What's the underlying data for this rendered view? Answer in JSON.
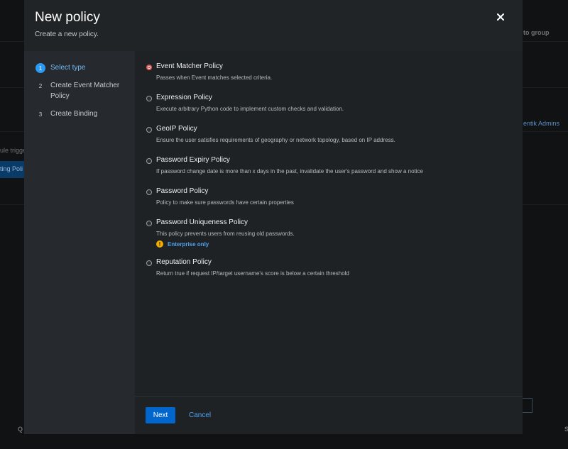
{
  "background": {
    "top_right_text": "to group",
    "right_text": "entik Admins",
    "left_text_1": "ule trigge",
    "left_chip_text": "ting Poli",
    "bottom_left_letter": "Q",
    "bottom_right_letter": "S"
  },
  "modal": {
    "title": "New policy",
    "description": "Create a new policy.",
    "close_glyph": "✕"
  },
  "steps": [
    {
      "number": "1",
      "label": "Select type",
      "current": true
    },
    {
      "number": "2",
      "label": "Create Event Matcher Policy",
      "current": false
    },
    {
      "number": "3",
      "label": "Create Binding",
      "current": false
    }
  ],
  "policies": [
    {
      "label": "Event Matcher Policy",
      "description": "Passes when Event matches selected criteria.",
      "checked": true
    },
    {
      "label": "Expression Policy",
      "description": "Execute arbitrary Python code to implement custom checks and validation.",
      "checked": false
    },
    {
      "label": "GeoIP Policy",
      "description": "Ensure the user satisfies requirements of geography or network topology, based on IP address.",
      "checked": false
    },
    {
      "label": "Password Expiry Policy",
      "description": "If password change date is more than x days in the past, invalidate the user's password and show a notice",
      "checked": false
    },
    {
      "label": "Password Policy",
      "description": "Policy to make sure passwords have certain properties",
      "checked": false
    },
    {
      "label": "Password Uniqueness Policy",
      "description": "This policy prevents users from reusing old passwords.",
      "checked": false,
      "badge": "Enterprise only"
    },
    {
      "label": "Reputation Policy",
      "description": "Return true if request IP/target username's score is below a certain threshold",
      "checked": false
    }
  ],
  "footer": {
    "next_label": "Next",
    "cancel_label": "Cancel"
  },
  "colors": {
    "accent": "#0066cc",
    "link": "#4da3ef",
    "radio_checked": "#c9190b",
    "warning": "#f0ab00"
  }
}
